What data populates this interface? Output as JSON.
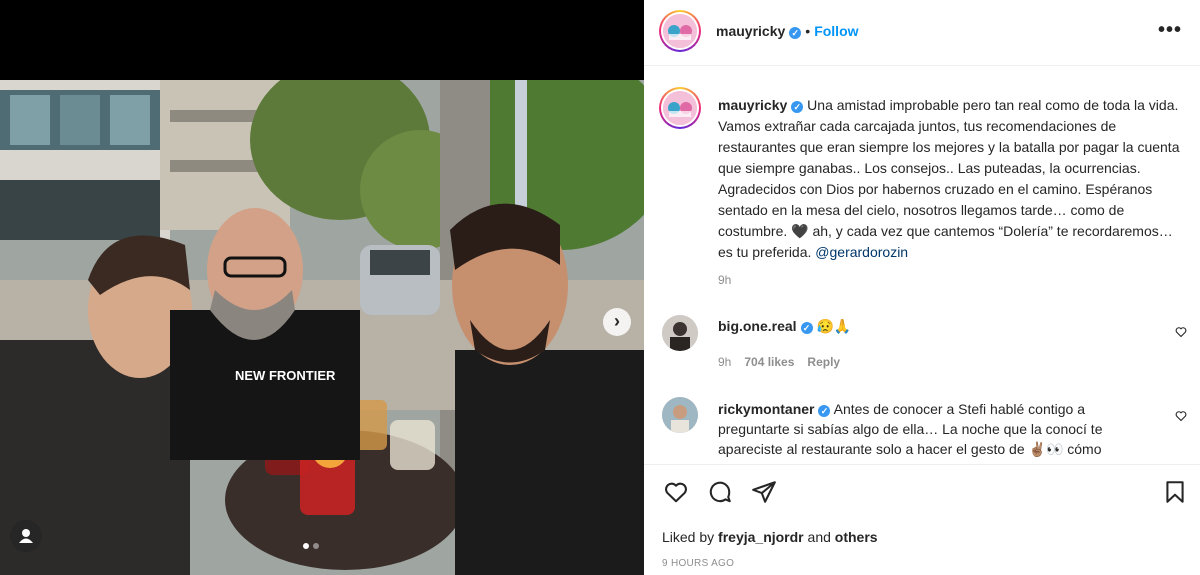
{
  "post": {
    "username": "mauyricky",
    "follow_label": "Follow",
    "more_label": "•••",
    "separator": "•",
    "caption_body": " Una amistad improbable pero tan real como de toda la vida. Vamos extrañar cada carcajada juntos, tus recomendaciones de restaurantes que eran siempre los mejores y la batalla por pagar la cuenta que siempre ganabas.. Los consejos.. Las puteadas, la ocurrencias. Agradecidos con Dios por habernos cruzado en el camino. Espéranos sentado en la mesa del cielo, nosotros llegamos tarde… como de costumbre. 🖤 ah, y cada vez que cantemos “Dolería” te recordaremos… es tu preferida. ",
    "caption_mention": "@gerardorozin",
    "caption_time": "9h",
    "carousel_next": "›",
    "photo_alt_sign": "NEW FRONTIER"
  },
  "comments": [
    {
      "username": "big.one.real",
      "text": " 😥🙏",
      "time": "9h",
      "likes": "704 likes",
      "reply": "Reply"
    },
    {
      "username": "rickymontaner",
      "text": " Antes de conocer a Stefi hablé contigo a preguntarte si sabías algo de ella… La noche que la conocí te apareciste al restaurante solo a hacer el gesto de ✌🏽👀 cómo"
    }
  ],
  "footer": {
    "liked_prefix": "Liked by ",
    "liked_user": "freyja_njordr",
    "liked_and": " and ",
    "liked_others": "others",
    "timestamp": "9 HOURS AGO"
  },
  "icons": {
    "verified": "✓",
    "like": "heart-icon",
    "comment": "comment-icon",
    "share": "share-icon",
    "save": "bookmark-icon"
  },
  "colors": {
    "link_blue": "#0095f6",
    "verified_blue": "#3897f0",
    "muted": "#8e8e8e"
  }
}
